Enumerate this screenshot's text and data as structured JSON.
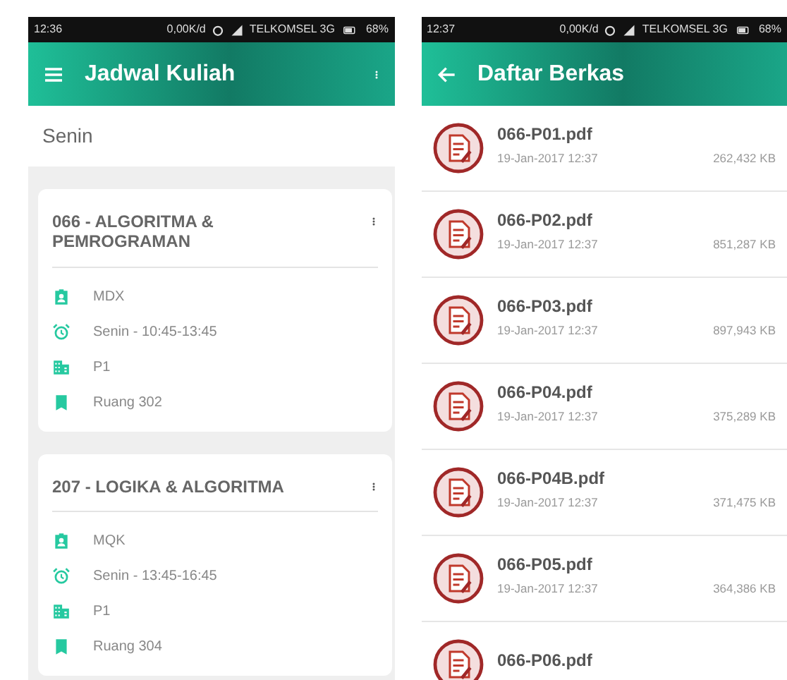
{
  "screens": [
    {
      "kind": "schedule",
      "status_bar": {
        "time": "12:36",
        "speed": "0,00K/d",
        "carrier": "TELKOMSEL 3G",
        "battery": "68%"
      },
      "toolbar": {
        "kind": "menu",
        "title": "Jadwal Kuliah",
        "has_overflow": true
      },
      "section": "Senin",
      "courses": [
        {
          "title": "066 - ALGORITMA & PEMROGRAMAN",
          "details": [
            {
              "kind": "lecturer",
              "text": "MDX"
            },
            {
              "kind": "time",
              "text": "Senin - 10:45-13:45"
            },
            {
              "kind": "building",
              "text": "P1"
            },
            {
              "kind": "room",
              "text": "Ruang 302"
            }
          ]
        },
        {
          "title": "207 - LOGIKA & ALGORITMA",
          "details": [
            {
              "kind": "lecturer",
              "text": "MQK"
            },
            {
              "kind": "time",
              "text": "Senin - 13:45-16:45"
            },
            {
              "kind": "building",
              "text": "P1"
            },
            {
              "kind": "room",
              "text": "Ruang 304"
            }
          ]
        }
      ]
    },
    {
      "kind": "files",
      "status_bar": {
        "time": "12:37",
        "speed": "0,00K/d",
        "carrier": "TELKOMSEL 3G",
        "battery": "68%"
      },
      "toolbar": {
        "kind": "back",
        "title": "Daftar Berkas",
        "has_overflow": false
      },
      "files": [
        {
          "name": "066-P01.pdf",
          "date": "19-Jan-2017 12:37",
          "size": "262,432 KB"
        },
        {
          "name": "066-P02.pdf",
          "date": "19-Jan-2017 12:37",
          "size": "851,287 KB"
        },
        {
          "name": "066-P03.pdf",
          "date": "19-Jan-2017 12:37",
          "size": "897,943 KB"
        },
        {
          "name": "066-P04.pdf",
          "date": "19-Jan-2017 12:37",
          "size": "375,289 KB"
        },
        {
          "name": "066-P04B.pdf",
          "date": "19-Jan-2017 12:37",
          "size": "371,475 KB"
        },
        {
          "name": "066-P05.pdf",
          "date": "19-Jan-2017 12:37",
          "size": "364,386 KB"
        },
        {
          "name": "066-P06.pdf"
        }
      ]
    }
  ]
}
